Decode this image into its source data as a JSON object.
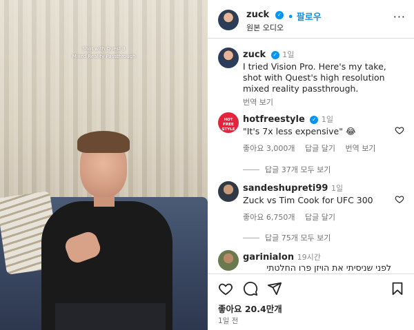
{
  "media": {
    "overlay_line1": "Shot with Quest 3",
    "overlay_line2": "Mixed Reality Passthrough"
  },
  "header": {
    "username": "zuck",
    "follow_label": "팔로우",
    "audio_label": "원본 오디오",
    "more_icon": "more-horizontal-icon"
  },
  "caption": {
    "username": "zuck",
    "time": "1일",
    "text": "I tried Vision Pro. Here's my take, shot with Quest's high resolution mixed reality passthrough.",
    "translate_label": "번역 보기"
  },
  "comments": [
    {
      "username": "hotfreestyle",
      "avatar_text": "HOT FREE STYLE",
      "time": "1일",
      "text": "\"It's 7x less expensive\" 😂",
      "likes": "좋아요 3,000개",
      "reply": "답글 달기",
      "translate": "번역 보기",
      "thread": "답글 37개 모두 보기"
    },
    {
      "username": "sandeshupreti99",
      "time": "1일",
      "text": "Zuck vs Tim Cook for UFC 300",
      "likes": "좋아요 6,750개",
      "reply": "답글 달기",
      "thread": "답글 75개 모두 보기"
    },
    {
      "username": "garinialon",
      "time": "19시간",
      "text": "לפני שניסיתי את הויזן פרו החלטתי"
    }
  ],
  "footer": {
    "likes": "좋아요 20.4만개",
    "time": "1일 전",
    "icons": [
      "heart-icon",
      "comment-icon",
      "share-icon",
      "bookmark-icon"
    ]
  },
  "colors": {
    "accent": "#0095f6",
    "text": "#262626",
    "secondary": "#737373"
  }
}
